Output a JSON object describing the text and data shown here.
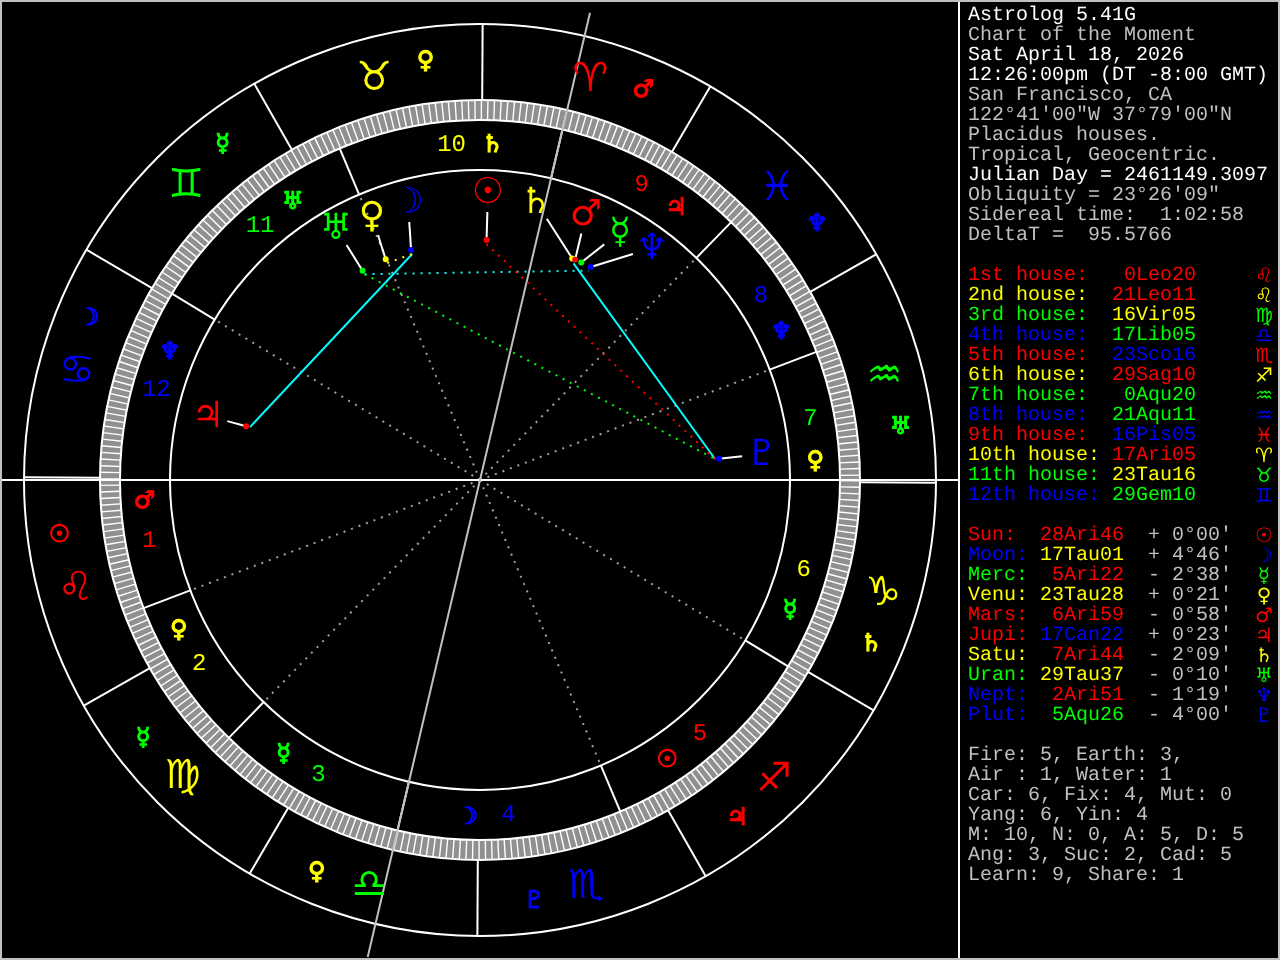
{
  "header": [
    {
      "text": "Astrolog 5.41G",
      "kind": "bright"
    },
    {
      "text": "Chart of the Moment",
      "kind": "dim"
    },
    {
      "text": "Sat April 18, 2026",
      "kind": "bright"
    },
    {
      "text": "12:26:00pm (DT -8:00 GMT)",
      "kind": "bright"
    },
    {
      "text": "San Francisco, CA",
      "kind": "dim"
    },
    {
      "text": "122°41'00\"W 37°79'00\"N",
      "kind": "dim"
    },
    {
      "text": "Placidus houses.",
      "kind": "dim"
    },
    {
      "text": "Tropical, Geocentric.",
      "kind": "dim"
    },
    {
      "text": "Julian Day = 2461149.3097",
      "kind": "bright"
    },
    {
      "text": "Obliquity = 23°26'09\"",
      "kind": "dim"
    },
    {
      "text": "Sidereal time:  1:02:58",
      "kind": "dim"
    },
    {
      "text": "DeltaT =  95.5766",
      "kind": "dim"
    }
  ],
  "houses": [
    {
      "label": "1st house:",
      "glyph": "♌",
      "color": "#ff0000",
      "position": {
        "text": "0Leo20",
        "color": "#ff0000"
      }
    },
    {
      "label": "2nd house:",
      "glyph": "♌",
      "color": "#ffff00",
      "position": {
        "text": "21Leo11",
        "color": "#ff0000"
      }
    },
    {
      "label": "3rd house:",
      "glyph": "♍",
      "color": "#00ff00",
      "position": {
        "text": "16Vir05",
        "color": "#ffff00"
      }
    },
    {
      "label": "4th house:",
      "glyph": "♎",
      "color": "#0000ff",
      "position": {
        "text": "17Lib05",
        "color": "#00ff00"
      }
    },
    {
      "label": "5th house:",
      "glyph": "♏",
      "color": "#ff0000",
      "position": {
        "text": "23Sco16",
        "color": "#0000ff"
      }
    },
    {
      "label": "6th house:",
      "glyph": "♐",
      "color": "#ffff00",
      "position": {
        "text": "29Sag10",
        "color": "#ff0000"
      }
    },
    {
      "label": "7th house:",
      "glyph": "♒",
      "color": "#00ff00",
      "position": {
        "text": "0Aqu20",
        "color": "#00ff00"
      }
    },
    {
      "label": "8th house:",
      "glyph": "♒",
      "color": "#0000ff",
      "position": {
        "text": "21Aqu11",
        "color": "#00ff00"
      }
    },
    {
      "label": "9th house:",
      "glyph": "♓",
      "color": "#ff0000",
      "position": {
        "text": "16Pis05",
        "color": "#0000ff"
      }
    },
    {
      "label": "10th house:",
      "glyph": "♈",
      "color": "#ffff00",
      "position": {
        "text": "17Ari05",
        "color": "#ff0000"
      }
    },
    {
      "label": "11th house:",
      "glyph": "♉",
      "color": "#00ff00",
      "position": {
        "text": "23Tau16",
        "color": "#ffff00"
      }
    },
    {
      "label": "12th house:",
      "glyph": "♊",
      "color": "#0000ff",
      "position": {
        "text": "29Gem10",
        "color": "#00ff00"
      }
    }
  ],
  "planets": [
    {
      "name": "Sun:",
      "latitude": "+ 0°00'",
      "glyph": "☉",
      "color": "#ff0000",
      "position": {
        "text": "28Ari46",
        "color": "#ff0000"
      }
    },
    {
      "name": "Moon:",
      "latitude": "+ 4°46'",
      "glyph": "☽",
      "color": "#0000ff",
      "position": {
        "text": "17Tau01",
        "color": "#ffff00"
      }
    },
    {
      "name": "Merc:",
      "latitude": "- 2°38'",
      "glyph": "☿",
      "color": "#00ff00",
      "position": {
        "text": "5Ari22",
        "color": "#ff0000"
      }
    },
    {
      "name": "Venu:",
      "latitude": "+ 0°21'",
      "glyph": "♀",
      "color": "#ffff00",
      "position": {
        "text": "23Tau28",
        "color": "#ffff00"
      }
    },
    {
      "name": "Mars:",
      "latitude": "- 0°58'",
      "glyph": "♂",
      "color": "#ff0000",
      "position": {
        "text": "6Ari59",
        "color": "#ff0000"
      }
    },
    {
      "name": "Jupi:",
      "latitude": "+ 0°23'",
      "glyph": "♃",
      "color": "#ff0000",
      "position": {
        "text": "17Can22",
        "color": "#0000ff"
      }
    },
    {
      "name": "Satu:",
      "latitude": "- 2°09'",
      "glyph": "♄",
      "color": "#ffff00",
      "position": {
        "text": "7Ari44",
        "color": "#ff0000"
      }
    },
    {
      "name": "Uran:",
      "latitude": "- 0°10'",
      "glyph": "♅",
      "color": "#00ff00",
      "position": {
        "text": "29Tau37",
        "color": "#ffff00"
      }
    },
    {
      "name": "Nept:",
      "latitude": "- 1°19'",
      "glyph": "♆",
      "color": "#0000ff",
      "position": {
        "text": "2Ari51",
        "color": "#ff0000"
      }
    },
    {
      "name": "Plut:",
      "latitude": "- 4°00'",
      "glyph": "♇",
      "color": "#0000ff",
      "position": {
        "text": "5Aqu26",
        "color": "#00ff00"
      }
    }
  ],
  "summary": [
    "Fire: 5, Earth: 3,",
    "Air : 1, Water: 1",
    "Car: 6, Fix: 4, Mut: 0",
    "Yang: 6, Yin: 4",
    "M: 10, N: 0, A: 5, D: 5",
    "Ang: 3, Suc: 2, Cad: 5",
    "Learn: 9, Share: 1"
  ],
  "wheel": {
    "signs": [
      {
        "glyph": "♉",
        "color": "#ffff00",
        "ruler": {
          "glyph": "♀",
          "color": "#ffff00"
        }
      },
      {
        "glyph": "♈",
        "color": "#ff0000",
        "ruler": {
          "glyph": "♂",
          "color": "#ff0000"
        }
      },
      {
        "glyph": "♊",
        "color": "#00ff00",
        "ruler": {
          "glyph": "☿",
          "color": "#00ff00"
        }
      },
      {
        "glyph": "♓",
        "color": "#0000ff",
        "ruler": {
          "glyph": "♆",
          "color": "#0000ff"
        }
      },
      {
        "glyph": "♋",
        "color": "#0000ff",
        "ruler": {
          "glyph": "☽",
          "color": "#0000ff"
        }
      },
      {
        "glyph": "♒",
        "color": "#00ff00",
        "ruler": {
          "glyph": "♅",
          "color": "#00ff00"
        }
      },
      {
        "glyph": "♌",
        "color": "#ff0000",
        "ruler": {
          "glyph": "☉",
          "color": "#ff0000"
        }
      },
      {
        "glyph": "♑",
        "color": "#ffff00",
        "ruler": {
          "glyph": "♄",
          "color": "#ffff00"
        }
      },
      {
        "glyph": "♍",
        "color": "#ffff00",
        "ruler": {
          "glyph": "☿",
          "color": "#00ff00"
        }
      },
      {
        "glyph": "♐",
        "color": "#ff0000",
        "ruler": {
          "glyph": "♃",
          "color": "#ff0000"
        }
      },
      {
        "glyph": "♎",
        "color": "#00ff00",
        "ruler": {
          "glyph": "♀",
          "color": "#ffff00"
        }
      },
      {
        "glyph": "♏",
        "color": "#0000ff",
        "ruler": {
          "glyph": "♇",
          "color": "#0000ff"
        }
      }
    ],
    "houses": [
      {
        "number": "10",
        "color": "#ffff00",
        "ruler": {
          "glyph": "♄",
          "color": "#ffff00"
        }
      },
      {
        "number": "9",
        "color": "#ff0000",
        "ruler": {
          "glyph": "♃",
          "color": "#ff0000"
        }
      },
      {
        "number": "11",
        "color": "#00ff00",
        "ruler": {
          "glyph": "♅",
          "color": "#00ff00"
        }
      },
      {
        "number": "8",
        "color": "#0000ff",
        "ruler": {
          "glyph": "♆",
          "color": "#0000ff"
        }
      },
      {
        "number": "12",
        "color": "#0000ff",
        "ruler": {
          "glyph": "♆",
          "color": "#0000ff"
        }
      },
      {
        "number": "7",
        "color": "#00ff00",
        "ruler": {
          "glyph": "♀",
          "color": "#ffff00"
        }
      },
      {
        "number": "1",
        "color": "#ff0000",
        "ruler": {
          "glyph": "♂",
          "color": "#ff0000"
        }
      },
      {
        "number": "6",
        "color": "#ffff00",
        "ruler": {
          "glyph": "☿",
          "color": "#00ff00"
        }
      },
      {
        "number": "2",
        "color": "#ffff00",
        "ruler": {
          "glyph": "♀",
          "color": "#ffff00"
        }
      },
      {
        "number": "5",
        "color": "#ff0000",
        "ruler": {
          "glyph": "☉",
          "color": "#ff0000"
        }
      },
      {
        "number": "3",
        "color": "#00ff00",
        "ruler": {
          "glyph": "☿",
          "color": "#00ff00"
        }
      },
      {
        "number": "4",
        "color": "#0000ff",
        "ruler": {
          "glyph": "☽",
          "color": "#0000ff"
        }
      }
    ],
    "planets": [
      {
        "glyph": "♅",
        "color": "#00ff00"
      },
      {
        "glyph": "♀",
        "color": "#ffff00"
      },
      {
        "glyph": "☽",
        "color": "#0000ff"
      },
      {
        "glyph": "☉",
        "color": "#ff0000"
      },
      {
        "glyph": "♄",
        "color": "#ffff00"
      },
      {
        "glyph": "♂",
        "color": "#ff0000"
      },
      {
        "glyph": "☿",
        "color": "#00ff00"
      },
      {
        "glyph": "♆",
        "color": "#0000ff"
      },
      {
        "glyph": "♃",
        "color": "#ff0000"
      },
      {
        "glyph": "♇",
        "color": "#0000ff"
      }
    ]
  }
}
